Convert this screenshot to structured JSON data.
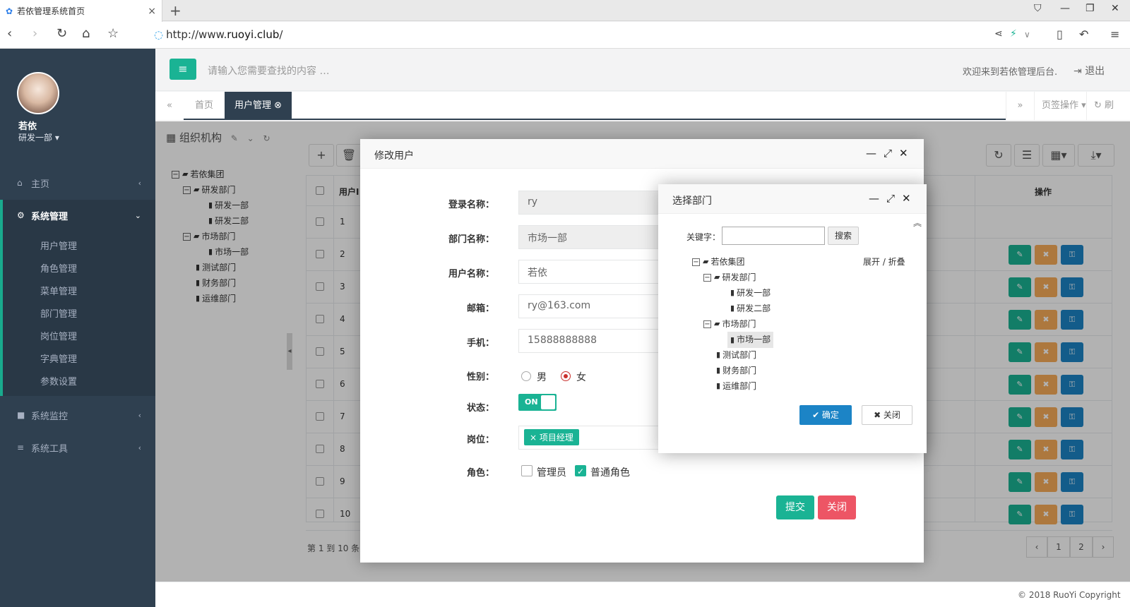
{
  "browser": {
    "tab_title": "若依管理系统首页",
    "url_prefix": "http://www.",
    "url_domain": "ruoyi.club",
    "url_suffix": "/"
  },
  "user": {
    "name": "若依",
    "dept": "研发一部 ▾"
  },
  "sidebar": {
    "items": [
      {
        "label": "主页",
        "icon": "home-icon"
      },
      {
        "label": "系统管理",
        "icon": "gear-icon"
      },
      {
        "label": "系统监控",
        "icon": "video-icon"
      },
      {
        "label": "系统工具",
        "icon": "bars-icon"
      }
    ],
    "subitems": [
      "用户管理",
      "角色管理",
      "菜单管理",
      "部门管理",
      "岗位管理",
      "字典管理",
      "参数设置"
    ]
  },
  "header": {
    "search_placeholder": "请输入您需要查找的内容 …",
    "welcome": "欢迎来到若依管理后台.",
    "logout": "退出"
  },
  "pagetabs": {
    "home": "首页",
    "active": "用户管理",
    "tab_ops": "页签操作",
    "refresh": "刷新"
  },
  "org": {
    "title": "组织机构",
    "tree": {
      "root": "若依集团",
      "rd": "研发部门",
      "rd1": "研发一部",
      "rd2": "研发二部",
      "mk": "市场部门",
      "mk1": "市场一部",
      "test": "测试部门",
      "fin": "财务部门",
      "ops": "运维部门"
    }
  },
  "table": {
    "col_user": "用户I",
    "col_ops": "操作",
    "rows": [
      "1",
      "2",
      "3",
      "4",
      "5",
      "6",
      "7",
      "8",
      "9",
      "10"
    ],
    "footer_text": "第 1 到 10 条",
    "pages": [
      "‹",
      "1",
      "2",
      "›"
    ]
  },
  "edit_dialog": {
    "title": "修改用户",
    "fields": {
      "login_label": "登录名称：",
      "login_value": "ry",
      "dept_label": "部门名称：",
      "dept_value": "市场一部",
      "name_label": "用户名称：",
      "name_value": "若依",
      "email_label": "邮箱：",
      "email_value": "ry@163.com",
      "phone_label": "手机：",
      "phone_value": "15888888888",
      "gender_label": "性别：",
      "gender_male": "男",
      "gender_female": "女",
      "status_label": "状态：",
      "status_value": "ON",
      "post_label": "岗位：",
      "post_tag": "× 项目经理",
      "role_label": "角色：",
      "role_admin": "管理员",
      "role_common": "普通角色"
    },
    "submit": "提交",
    "close": "关闭"
  },
  "dept_dialog": {
    "title": "选择部门",
    "keyword_label": "关键字：",
    "search": "搜索",
    "expand_collapse": "展开 / 折叠",
    "confirm": "✔ 确定",
    "close": "✖ 关闭"
  },
  "footer": {
    "copyright": "© 2018 RuoYi Copyright"
  },
  "colors": {
    "sidebar": "#2f4050",
    "primary": "#1ab394",
    "danger": "#ed5565",
    "info": "#1c84c6",
    "warning": "#f8ac59"
  }
}
